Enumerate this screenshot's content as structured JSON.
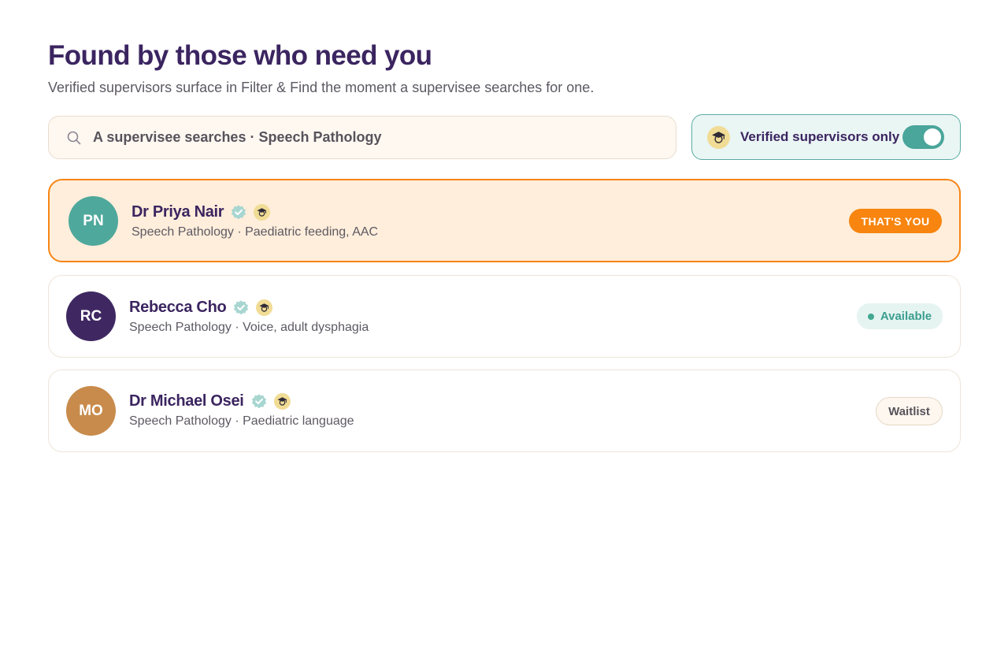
{
  "header": {
    "title": "Found by those who need you",
    "subtitle": "Verified supervisors surface in Filter & Find the moment a supervisee searches for one."
  },
  "search": {
    "icon": "search-icon",
    "query": "A supervisee searches · Speech Pathology"
  },
  "filter": {
    "icon": "graduation-cap-icon",
    "label": "Verified supervisors only",
    "enabled": true
  },
  "colors": {
    "brand_purple": "#3b2560",
    "accent_orange": "#f7850f",
    "teal": "#4aa59a",
    "cap_badge": "#f1dc95"
  },
  "results": [
    {
      "initials": "PN",
      "name": "Dr Priya Nair",
      "detail": "Speech Pathology · Paediatric feeding, AAC",
      "avatar_color": "#4fa89c",
      "status": "THAT'S YOU",
      "status_type": "you",
      "highlighted": true
    },
    {
      "initials": "RC",
      "name": "Rebecca Cho",
      "detail": "Speech Pathology · Voice, adult dysphagia",
      "avatar_color": "#3f2862",
      "status": "Available",
      "status_type": "available",
      "highlighted": false
    },
    {
      "initials": "MO",
      "name": "Dr Michael Osei",
      "detail": "Speech Pathology · Paediatric language",
      "avatar_color": "#c88b4c",
      "status": "Waitlist",
      "status_type": "waitlist",
      "highlighted": false
    }
  ]
}
